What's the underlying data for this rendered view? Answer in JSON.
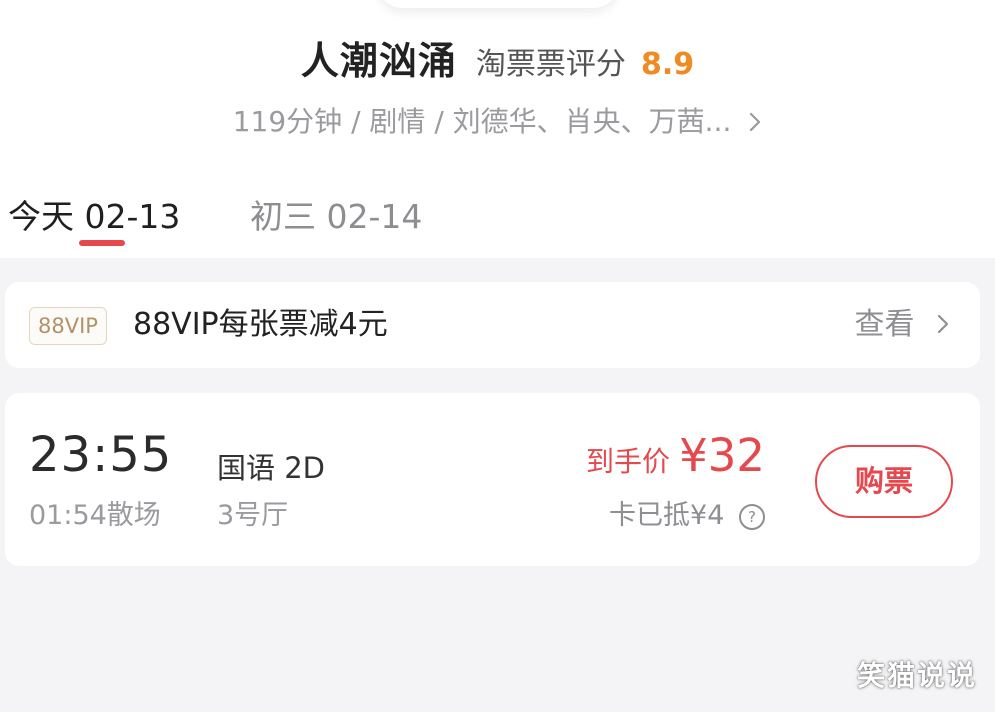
{
  "movie": {
    "title": "人潮汹涌",
    "rating_label": "淘票票评分",
    "rating_value": "8.9",
    "meta": "119分钟 / 剧情 / 刘德华、肖央、万茜..."
  },
  "date_tabs": [
    {
      "label": "今天 02-13",
      "active": true
    },
    {
      "label": "初三 02-14",
      "active": false
    }
  ],
  "vip": {
    "badge": "88VIP",
    "text": "88VIP每张票减4元",
    "view_label": "查看"
  },
  "showtime": {
    "start": "23:55",
    "end": "01:54散场",
    "language": "国语 2D",
    "hall": "3号厅",
    "price_label": "到手价",
    "price": "¥32",
    "discount": "卡已抵¥4",
    "buy_label": "购票"
  },
  "watermark": "笑猫说说",
  "icons": {
    "help": "question-circle-icon",
    "chevron": "chevron-right-icon"
  },
  "colors": {
    "accent_red": "#e5484d",
    "rating_orange": "#f08a22",
    "vip_gold": "#b3916a"
  }
}
